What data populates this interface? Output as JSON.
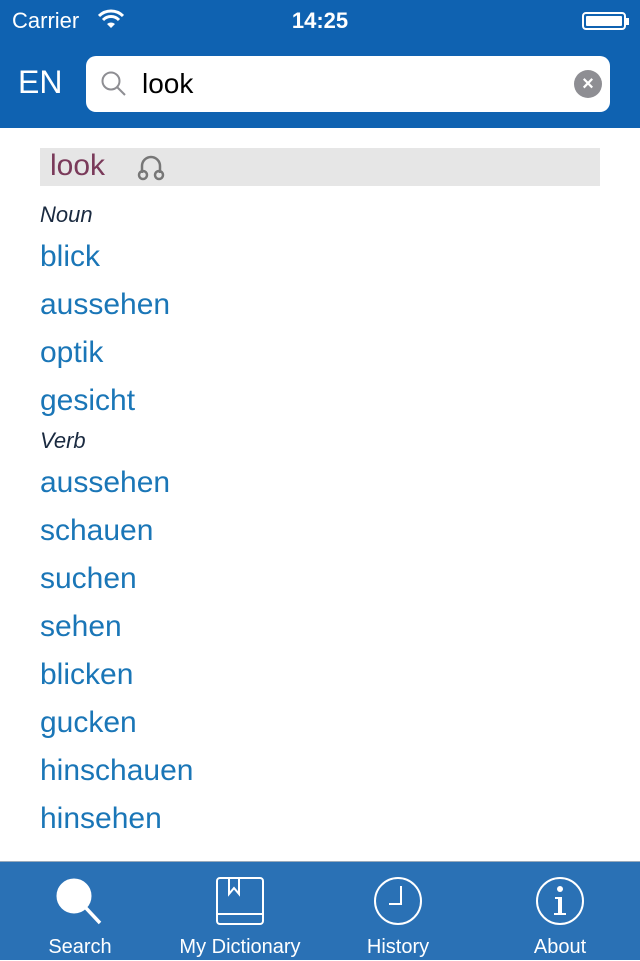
{
  "status_bar": {
    "carrier": "Carrier",
    "time": "14:25"
  },
  "header": {
    "language": "EN",
    "search": {
      "value": "look"
    }
  },
  "headword": {
    "word": "look"
  },
  "sections": [
    {
      "pos": "Noun",
      "items": [
        "blick",
        "aussehen",
        "optik",
        "gesicht"
      ]
    },
    {
      "pos": "Verb",
      "items": [
        "aussehen",
        "schauen",
        "suchen",
        "sehen",
        "blicken",
        "gucken",
        "hinschauen",
        "hinsehen"
      ]
    }
  ],
  "tabs": [
    {
      "label": "Search",
      "icon": "search-icon"
    },
    {
      "label": "My Dictionary",
      "icon": "book-icon"
    },
    {
      "label": "History",
      "icon": "clock-icon"
    },
    {
      "label": "About",
      "icon": "info-icon"
    }
  ],
  "colors": {
    "header": "#0f62b1",
    "tabbar": "#2a71b5",
    "link": "#1a76b7",
    "headword": "#7a3a5a"
  }
}
